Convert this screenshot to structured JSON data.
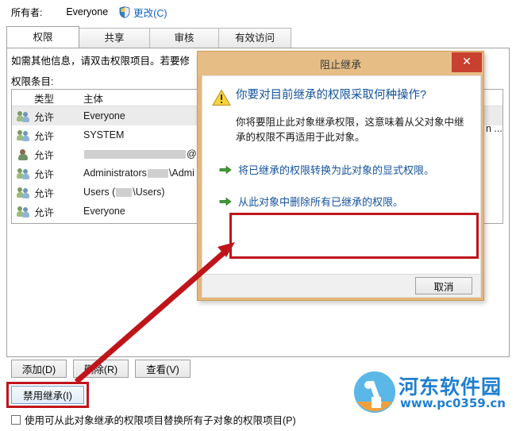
{
  "owner": {
    "label": "所有者:",
    "value": "Everyone",
    "change_link": "更改(C)",
    "shield_icon": "shield-icon"
  },
  "tabs": [
    {
      "label": "权限",
      "active": true
    },
    {
      "label": "共享",
      "active": false
    },
    {
      "label": "审核",
      "active": false
    },
    {
      "label": "有效访问",
      "active": false
    }
  ],
  "panel": {
    "hint": "如需其他信息，请双击权限项目。若要修",
    "entries_label": "权限条目:",
    "columns": {
      "type": "类型",
      "subject": "主体"
    },
    "rows": [
      {
        "icon": "group-icon",
        "type": "允许",
        "subject": "Everyone",
        "selected": true
      },
      {
        "icon": "group-icon",
        "type": "允许",
        "subject": "SYSTEM",
        "selected": false
      },
      {
        "icon": "user-icon",
        "type": "允许",
        "subject": "@gmail.com",
        "redacted_prefix": true,
        "selected": false
      },
      {
        "icon": "group-icon",
        "type": "允许",
        "subject": "Administrators",
        "suffix": "\\Admi",
        "redacted_middle": true,
        "selected": false
      },
      {
        "icon": "group-icon",
        "type": "允许",
        "subject": "Users (",
        "suffix": "\\Users)",
        "redacted_middle": true,
        "selected": false
      },
      {
        "icon": "group-icon",
        "type": "允许",
        "subject": "Everyone",
        "selected": false
      }
    ],
    "clipped_right_text": "n ..."
  },
  "buttons": {
    "add": "添加(D)",
    "remove": "删除(R)",
    "view": "查看(V)",
    "disable_inheritance": "禁用继承(I)"
  },
  "checkbox": {
    "label": "使用可从此对象继承的权限项目替换所有子对象的权限项目(P)",
    "checked": false
  },
  "dialog": {
    "title": "阻止继承",
    "close_label": "✕",
    "warning_icon": "warning-icon",
    "heading": "你要对目前继承的权限采取何种操作?",
    "description": "你将要阻止此对象继承权限，这意味着从父对象中继承的权限不再适用于此对象。",
    "options": [
      {
        "icon": "green-arrow-icon",
        "text": "将已继承的权限转换为此对象的显式权限。",
        "highlighted": false
      },
      {
        "icon": "green-arrow-icon",
        "text": "从此对象中删除所有已继承的权限。",
        "highlighted": true
      }
    ],
    "cancel": "取消"
  },
  "annotations": {
    "highlight_color": "#c0141b",
    "arrow_from": "禁用继承(I)",
    "arrow_to": "从此对象中删除所有已继承的权限。"
  },
  "watermark": {
    "site_name": "河东软件园",
    "url": "www.pc0359.cn",
    "logo_icon": "site-logo-icon"
  }
}
